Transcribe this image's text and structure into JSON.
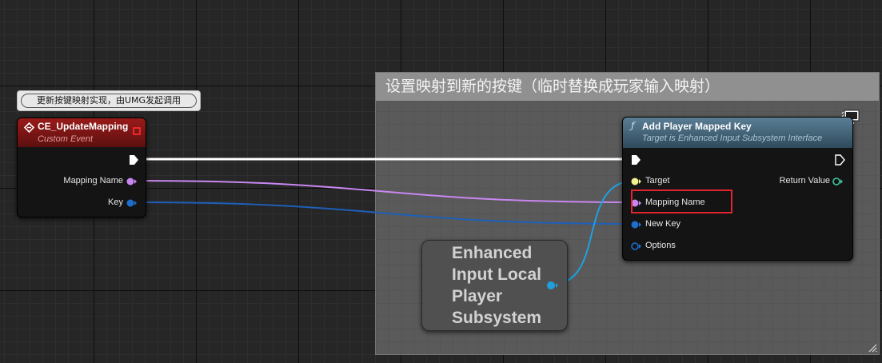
{
  "comment": {
    "title": "设置映射到新的按键（临时替换成玩家输入映射）"
  },
  "event_node": {
    "comment_bubble": "更新按键映射实现，由UMG发起调用",
    "title": "CE_UpdateMapping",
    "subtitle": "Custom Event",
    "pins": {
      "mapping_name": "Mapping Name",
      "key": "Key"
    }
  },
  "function_node": {
    "icon": "function-icon",
    "title": "Add Player Mapped Key",
    "subtitle": "Target is Enhanced Input Subsystem Interface",
    "inputs": {
      "target": "Target",
      "mapping_name": "Mapping Name",
      "new_key": "New Key",
      "options": "Options"
    },
    "outputs": {
      "return_value": "Return Value"
    },
    "corner_icon": "monitor-icon"
  },
  "variable_node": {
    "label": "Enhanced Input Local Player Subsystem"
  },
  "colors": {
    "exec_wire": "#ffffff",
    "name_pin": "#c887f0",
    "struct_pin": "#1e6ecd",
    "object_pin": "#1ea0e0",
    "target_pin": "#f0f08c",
    "return_pin": "#3cc8a0",
    "highlight": "#e0252f"
  }
}
